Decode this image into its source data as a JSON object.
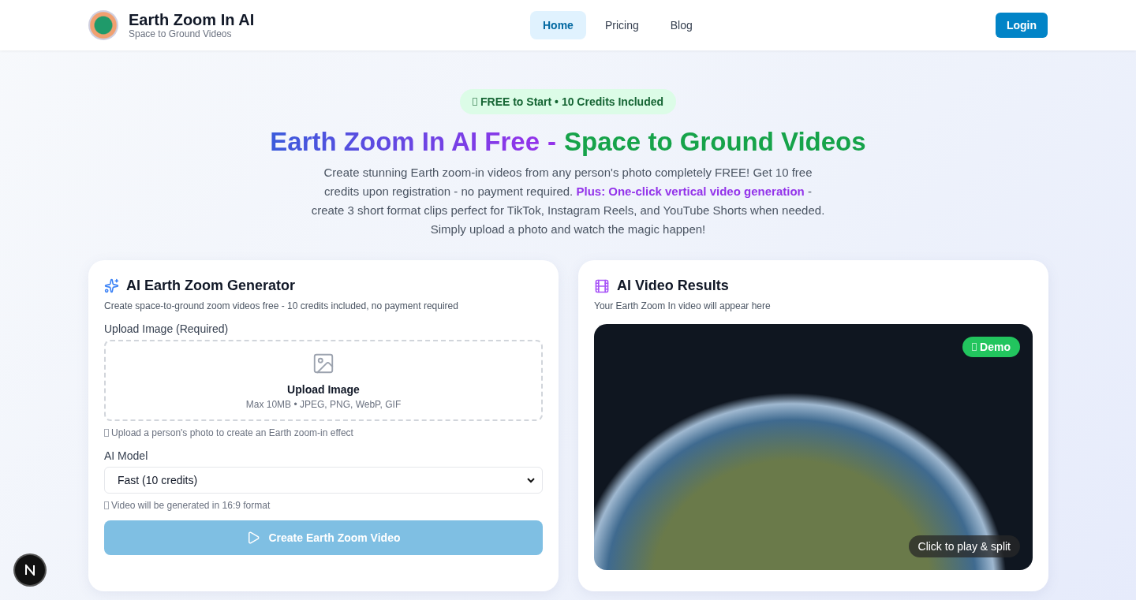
{
  "brand": {
    "title": "Earth Zoom In AI",
    "subtitle": "Space to Ground Videos"
  },
  "nav": [
    {
      "label": "Home",
      "selected": true
    },
    {
      "label": "Pricing",
      "selected": false
    },
    {
      "label": "Blog",
      "selected": false
    }
  ],
  "login": "Login",
  "hero": {
    "badge": "FREE to Start • 10 Credits Included",
    "title_part_1": "Earth Zoom In AI Free",
    "title_separator": "-",
    "title_part_2": "Space to Ground Videos",
    "description_1": "Create stunning Earth zoom-in videos from any person's photo completely FREE! Get 10 free credits upon registration - no payment required.",
    "description_highlight": "Plus: One-click vertical video generation",
    "description_2": "- create 3 short format clips perfect for TikTok, Instagram Reels, and YouTube Shorts when needed. Simply upload a photo and watch the magic happen!"
  },
  "generator": {
    "title": "AI Earth Zoom Generator",
    "subtitle": "Create space-to-ground zoom videos free - 10 credits included, no payment required",
    "upload_label": "Upload Image (Required)",
    "upload_title": "Upload Image",
    "upload_hint": "Max 10MB • JPEG, PNG, WebP, GIF",
    "upload_note": "Upload a person's photo to create an Earth zoom-in effect",
    "model_label": "AI Model",
    "model_value": "Fast (10 credits)",
    "model_note": "Video will be generated in 16:9 format",
    "button": "Create Earth Zoom Video",
    "button_disabled": true
  },
  "results": {
    "title": "AI Video Results",
    "subtitle": "Your Earth Zoom In video will appear here",
    "demo_badge": "Demo",
    "play_hint": "Click to play & split"
  }
}
